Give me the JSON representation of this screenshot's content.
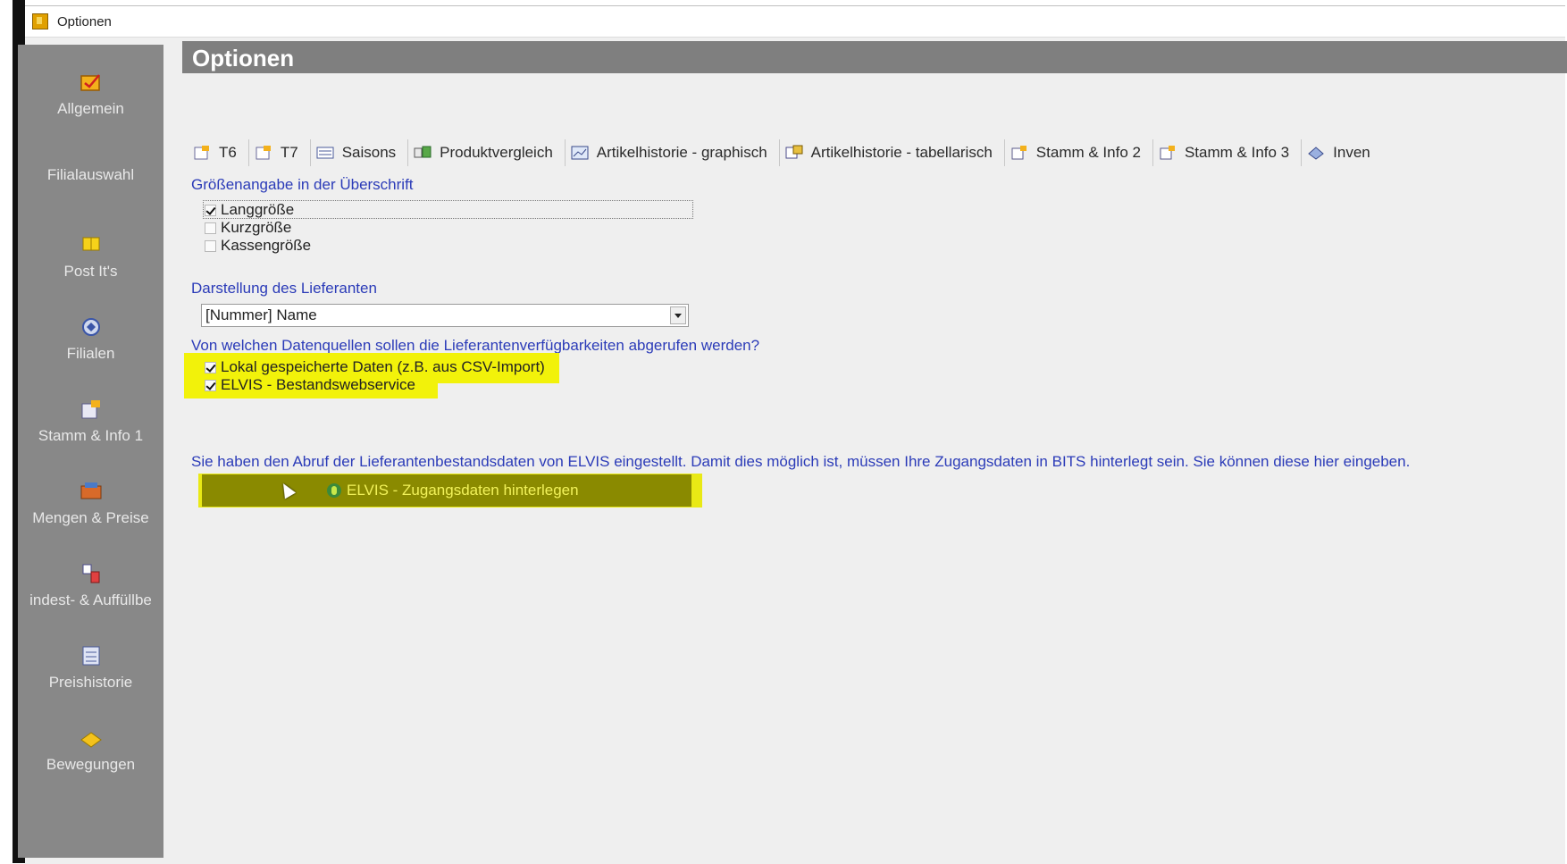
{
  "window": {
    "title": "Optionen"
  },
  "header": {
    "title": "Optionen"
  },
  "sidebar": {
    "items": [
      {
        "label": "Allgemein",
        "icon": "settings-form-icon"
      },
      {
        "label": "Filialauswahl",
        "icon": ""
      },
      {
        "label": "Post It's",
        "icon": "sticky-note-icon"
      },
      {
        "label": "Filialen",
        "icon": "branches-icon"
      },
      {
        "label": "Stamm & Info 1",
        "icon": "master-data-icon"
      },
      {
        "label": "Mengen & Preise",
        "icon": "quantities-prices-icon"
      },
      {
        "label": "indest- & Auffüllbe",
        "icon": "refill-icon"
      },
      {
        "label": "Preishistorie",
        "icon": "price-history-icon"
      },
      {
        "label": "Bewegungen",
        "icon": "movements-icon"
      }
    ]
  },
  "tabs": [
    {
      "label": "T6",
      "icon": "form-edit-icon"
    },
    {
      "label": "T7",
      "icon": "form-edit-icon"
    },
    {
      "label": "Saisons",
      "icon": "list-icon"
    },
    {
      "label": "Produktvergleich",
      "icon": "compare-icon"
    },
    {
      "label": "Artikelhistorie - graphisch",
      "icon": "chart-icon"
    },
    {
      "label": "Artikelhistorie - tabellarisch",
      "icon": "table-history-icon"
    },
    {
      "label": "Stamm & Info 2",
      "icon": "master-data-icon"
    },
    {
      "label": "Stamm & Info 3",
      "icon": "master-data-icon"
    },
    {
      "label": "Inven",
      "icon": "inventory-icon"
    }
  ],
  "size_section": {
    "label": "Größenangabe in der Überschrift",
    "options": [
      {
        "label": "Langgröße",
        "checked": true
      },
      {
        "label": "Kurzgröße",
        "checked": false
      },
      {
        "label": "Kassengröße",
        "checked": false
      }
    ]
  },
  "supplier_section": {
    "label": "Darstellung des Lieferanten",
    "selected": "[Nummer] Name"
  },
  "datasource_section": {
    "label": "Von welchen Datenquellen sollen die Lieferantenverfügbarkeiten abgerufen werden?",
    "options": [
      {
        "label": "Lokal gespeicherte Daten (z.B. aus CSV-Import)",
        "checked": true
      },
      {
        "label": "ELVIS - Bestandswebservice",
        "checked": true
      }
    ]
  },
  "elvis_section": {
    "info": "Sie haben den Abruf der Lieferantenbestandsdaten von ELVIS eingestellt. Damit dies möglich ist, müssen Ihre Zugangsdaten in BITS hinterlegt sein. Sie können diese hier eingeben.",
    "button_label": "ELVIS - Zugangsdaten hinterlegen"
  },
  "colors": {
    "sidebar_bg": "#888888",
    "header_bg": "#7f7f7f",
    "label_blue": "#2b3bb8",
    "highlight_yellow": "#f2f20a",
    "button_bg": "#8a8a00"
  }
}
